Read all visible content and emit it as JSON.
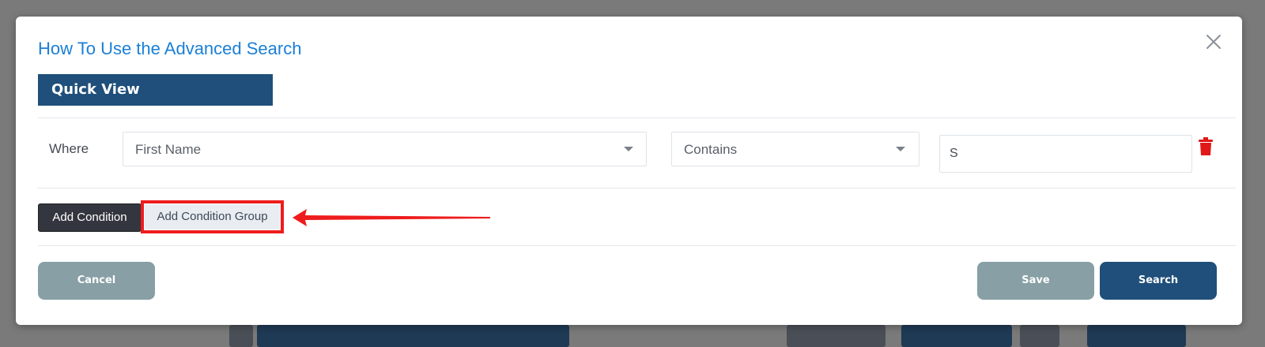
{
  "modal": {
    "title": "How To Use the Advanced Search",
    "close_icon": "close-icon"
  },
  "quick_view": {
    "label": "Quick View"
  },
  "condition": {
    "where_label": "Where",
    "field": {
      "selected": "First Name",
      "icon": "chevron-down-icon"
    },
    "operator": {
      "selected": "Contains",
      "icon": "chevron-down-icon"
    },
    "value": "S",
    "delete_icon": "trash-icon",
    "delete_color": "#e01818"
  },
  "actions": {
    "add_condition_label": "Add Condition",
    "add_condition_group_label": "Add Condition Group"
  },
  "annotation": {
    "highlight_color": "#ee1c1c",
    "arrow_icon": "arrow-left-icon"
  },
  "footer": {
    "cancel_label": "Cancel",
    "save_label": "Save",
    "search_label": "Search"
  },
  "colors": {
    "accent_blue": "#1a7fd6",
    "navy": "#1f4f7a",
    "muted_teal": "#879fa5",
    "dark_button": "#33363f"
  }
}
